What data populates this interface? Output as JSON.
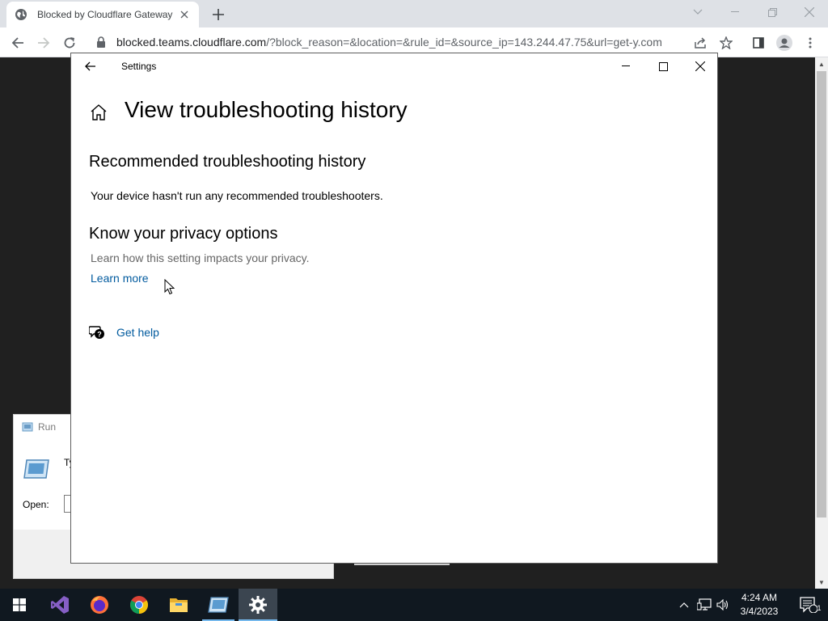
{
  "browser": {
    "tab_title": "Blocked by Cloudflare Gateway",
    "url_host": "blocked.teams.cloudflare.com",
    "url_rest": "/?block_reason=&location=&rule_id=&source_ip=143.244.47.75&url=get-y.com"
  },
  "run_dialog": {
    "title": "Run",
    "desc_partial": "Ty re",
    "open_label": "Open:"
  },
  "settings": {
    "window_title": "Settings",
    "page_title": "View troubleshooting history",
    "section1_heading": "Recommended troubleshooting history",
    "section1_text": "Your device hasn't run any recommended troubleshooters.",
    "section2_heading": "Know your privacy options",
    "section2_text": "Learn how this setting impacts your privacy.",
    "learn_more": "Learn more",
    "get_help": "Get help"
  },
  "taskbar": {
    "time": "4:24 AM",
    "date": "3/4/2023",
    "notification_count": "1"
  },
  "colors": {
    "link": "#005a9e",
    "taskbar": "#101820",
    "accent": "#76b9ed"
  }
}
